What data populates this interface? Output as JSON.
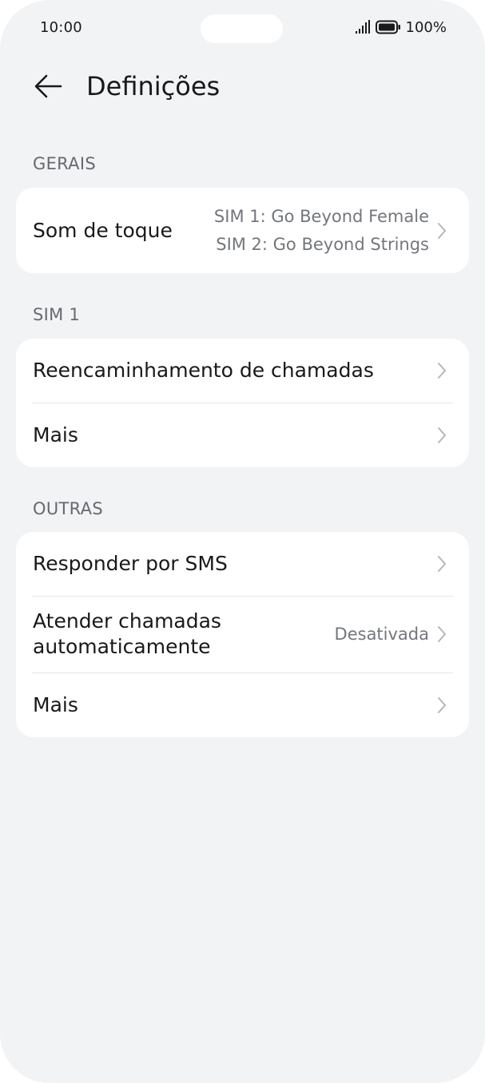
{
  "status_bar": {
    "time": "10:00",
    "battery": "100%"
  },
  "header": {
    "title": "Definições",
    "back_icon": "arrow-left-icon"
  },
  "sections": [
    {
      "label": "GERAIS",
      "items": [
        {
          "label": "Som de toque",
          "value_lines": [
            "SIM 1: Go Beyond Female",
            "SIM 2: Go Beyond Strings"
          ]
        }
      ]
    },
    {
      "label": "SIM 1",
      "items": [
        {
          "label": "Reencaminhamento de chamadas"
        },
        {
          "label": "Mais"
        }
      ]
    },
    {
      "label": "OUTRAS",
      "items": [
        {
          "label": "Responder por SMS"
        },
        {
          "label_lines": [
            "Atender chamadas",
            "automaticamente"
          ],
          "value": "Desativada"
        },
        {
          "label": "Mais"
        }
      ]
    }
  ],
  "colors": {
    "background": "#f1f3f5",
    "card": "#ffffff",
    "primary_text": "#191919",
    "secondary_text": "#73767b",
    "section_label": "#666a70"
  }
}
